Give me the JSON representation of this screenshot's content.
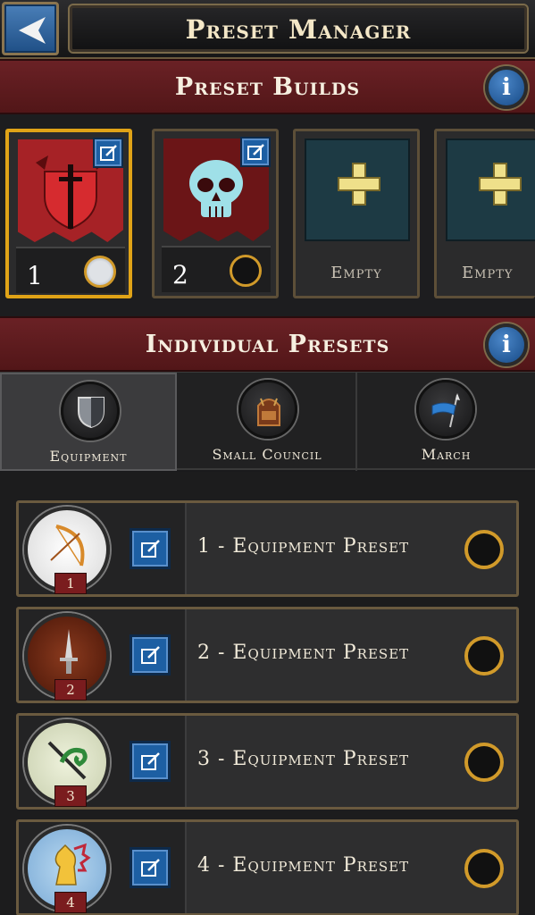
{
  "header": {
    "title": "Preset Manager"
  },
  "preset_builds": {
    "title": "Preset Builds",
    "info_label": "i",
    "cards": [
      {
        "number": "1",
        "emblem": "red-banner-sword-icon",
        "selected": true
      },
      {
        "number": "2",
        "emblem": "skull-banner-icon",
        "selected": false
      },
      {
        "label": "Empty"
      },
      {
        "label": "Empty"
      }
    ]
  },
  "individual_presets": {
    "title": "Individual Presets",
    "info_label": "i",
    "tabs": [
      {
        "label": "Equipment",
        "icon": "shield-icon"
      },
      {
        "label": "Small Council",
        "icon": "throne-icon"
      },
      {
        "label": "March",
        "icon": "banner-spear-icon"
      }
    ],
    "rows": [
      {
        "medal_number": "1",
        "label": "1 - Equipment Preset",
        "icon": "bow-icon"
      },
      {
        "medal_number": "2",
        "label": "2 - Equipment Preset",
        "icon": "dagger-icon"
      },
      {
        "medal_number": "3",
        "label": "3 - Equipment Preset",
        "icon": "sword-serpent-icon"
      },
      {
        "medal_number": "4",
        "label": "4 - Equipment Preset",
        "icon": "horse-icon"
      }
    ]
  },
  "colors": {
    "accent_gold": "#e0a317",
    "banner_red": "#6a2125",
    "button_blue": "#1d5fa3"
  }
}
